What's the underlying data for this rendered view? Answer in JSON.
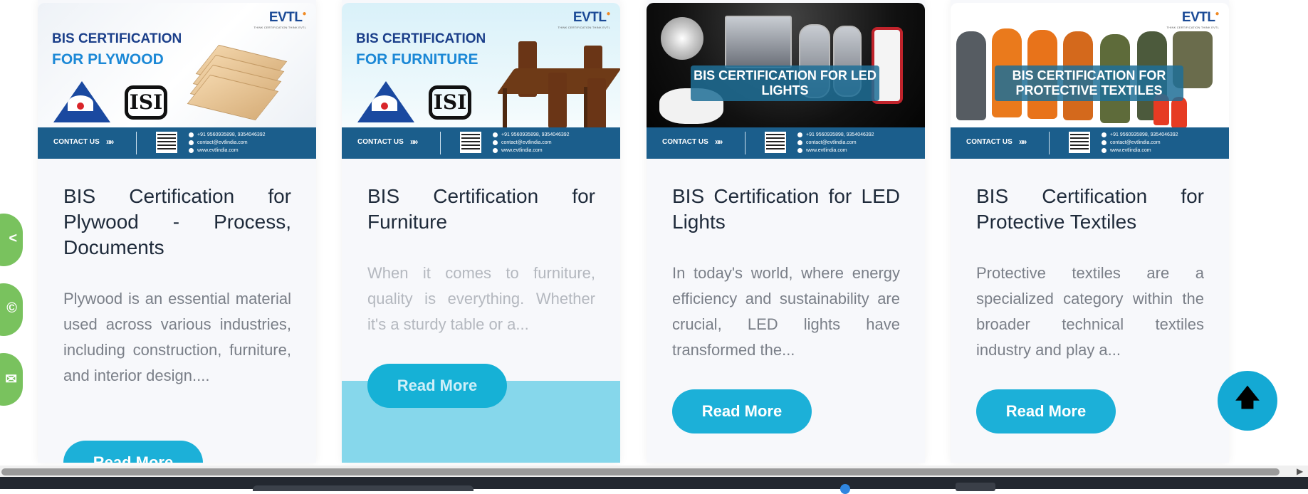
{
  "cards": [
    {
      "banner": {
        "line1": "BIS CERTIFICATION",
        "line2": "FOR PLYWOOD",
        "brand": "EVTL",
        "tagline": "THINK CERTIFICATION THINK EVTL"
      },
      "title": "BIS Certification for Plywood - Process, Documents",
      "excerpt": "Plywood is an essential material used across various industries, including construction, furniture, and interior design....",
      "button": "Read More"
    },
    {
      "banner": {
        "line1": "BIS CERTIFICATION",
        "line2": "FOR FURNITURE",
        "brand": "EVTL",
        "tagline": "THINK CERTIFICATION THINK EVTL"
      },
      "title": "BIS Certification for Furniture",
      "excerpt": "When it comes to furniture, quality is everything. Whether it's a sturdy table or a...",
      "button": "Read More"
    },
    {
      "banner": {
        "overlay": "BIS CERTIFICATION FOR LED LIGHTS"
      },
      "title": "BIS Certification for LED Lights",
      "excerpt": "In today's world, where energy efficiency and sustainability are crucial, LED lights have transformed the...",
      "button": "Read More"
    },
    {
      "banner": {
        "overlay": "BIS CERTIFICATION FOR PROTECTIVE TEXTILES",
        "brand": "EVTL",
        "tagline": "THINK CERTIFICATION THINK EVTL"
      },
      "title": "BIS Certification for Protective Textiles",
      "excerpt": "Protective textiles are a specialized category within the broader technical textiles industry and play a...",
      "button": "Read More"
    }
  ],
  "contact_bar": {
    "label": "CONTACT US",
    "arrows": "»»",
    "phone": "+91 9560935898, 9354046392",
    "email": "contact@evtlindia.com",
    "website": "www.evtlindia.com"
  },
  "logos": {
    "isi": "ISI"
  },
  "side_buttons": {
    "share_glyph": "<",
    "whatsapp_glyph": "©",
    "email_glyph": "✉"
  },
  "scroll_top": {
    "glyph": "🡅"
  },
  "colors": {
    "accent": "#1cb0d8",
    "contact_bar": "#1b5e8c",
    "side_buttons": "#79c25e",
    "title_text": "#1e2a3a"
  }
}
